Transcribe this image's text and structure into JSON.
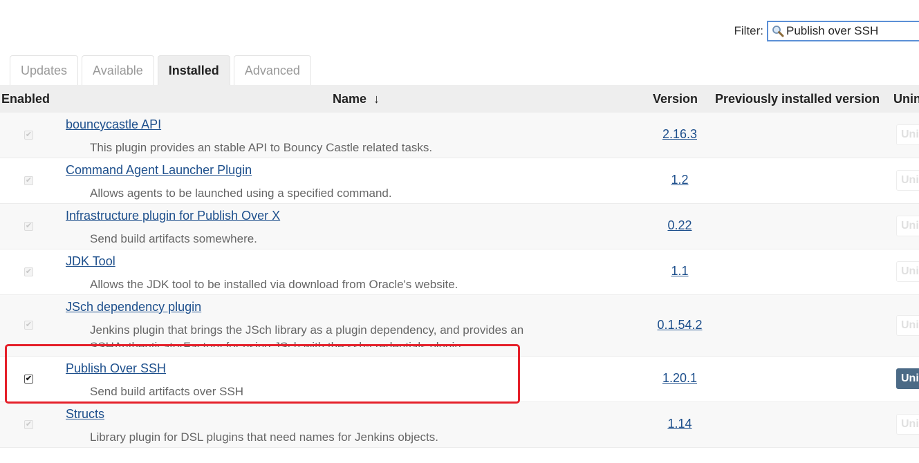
{
  "filter": {
    "label": "Filter:",
    "value": "Publish over SSH"
  },
  "tabs": [
    {
      "label": "Updates"
    },
    {
      "label": "Available"
    },
    {
      "label": "Installed",
      "active": true
    },
    {
      "label": "Advanced"
    }
  ],
  "table": {
    "headers": {
      "enabled": "Enabled",
      "name": "Name",
      "sort_arrow": "↓",
      "version": "Version",
      "previous": "Previously installed version",
      "uninstall": "Uninstall"
    },
    "rows": [
      {
        "name": "bouncycastle API",
        "description": "This plugin provides an stable API to Bouncy Castle related tasks.",
        "version": "2.16.3",
        "enabled": true,
        "uninstall_label": "Uninstall"
      },
      {
        "name": "Command Agent Launcher Plugin",
        "description": "Allows agents to be launched using a specified command.",
        "version": "1.2",
        "enabled": true,
        "uninstall_label": "Uninstall"
      },
      {
        "name": "Infrastructure plugin for Publish Over X",
        "description": "Send build artifacts somewhere.",
        "version": "0.22",
        "enabled": true,
        "uninstall_label": "Uninstall"
      },
      {
        "name": "JDK Tool",
        "description": "Allows the JDK tool to be installed via download from Oracle's website.",
        "version": "1.1",
        "enabled": true,
        "uninstall_label": "Uninstall"
      },
      {
        "name": "JSch dependency plugin",
        "description": "Jenkins plugin that brings the JSch library as a plugin dependency, and provides an SSHAuthenticatorFactory for using JSch with the ssh-credentials plugin.",
        "version": "0.1.54.2",
        "enabled": true,
        "uninstall_label": "Uninstall"
      },
      {
        "name": "Publish Over SSH",
        "description": "Send build artifacts over SSH",
        "version": "1.20.1",
        "enabled": true,
        "uninstall_label": "Uninstall"
      },
      {
        "name": "Structs",
        "description": "Library plugin for DSL plugins that need names for Jenkins objects.",
        "version": "1.14",
        "enabled": true,
        "uninstall_label": "Uninstall"
      }
    ]
  },
  "colors": {
    "link": "#1d4f8c",
    "highlight_border": "#e5202a",
    "uninstall_active": "#4b6a86",
    "filter_border": "#5b8fd6"
  }
}
